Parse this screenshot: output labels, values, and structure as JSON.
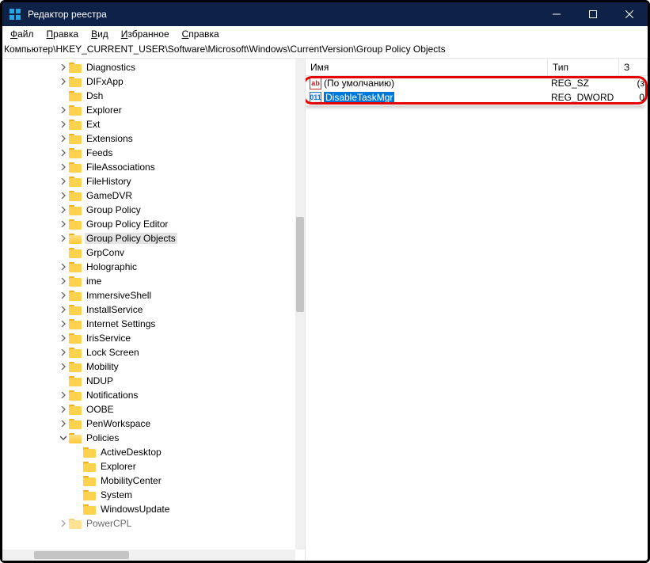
{
  "window": {
    "title": "Редактор реестра"
  },
  "menu": {
    "file": "Файл",
    "edit": "Правка",
    "view": "Вид",
    "favorites": "Избранное",
    "help": "Справка"
  },
  "addressbar": "Компьютер\\HKEY_CURRENT_USER\\Software\\Microsoft\\Windows\\CurrentVersion\\Group Policy Objects",
  "tree": [
    {
      "level": 0,
      "chev": ">",
      "label": "Diagnostics"
    },
    {
      "level": 0,
      "chev": ">",
      "label": "DIFxApp"
    },
    {
      "level": 0,
      "chev": "",
      "label": "Dsh"
    },
    {
      "level": 0,
      "chev": ">",
      "label": "Explorer"
    },
    {
      "level": 0,
      "chev": ">",
      "label": "Ext"
    },
    {
      "level": 0,
      "chev": ">",
      "label": "Extensions"
    },
    {
      "level": 0,
      "chev": ">",
      "label": "Feeds"
    },
    {
      "level": 0,
      "chev": ">",
      "label": "FileAssociations"
    },
    {
      "level": 0,
      "chev": ">",
      "label": "FileHistory"
    },
    {
      "level": 0,
      "chev": ">",
      "label": "GameDVR"
    },
    {
      "level": 0,
      "chev": ">",
      "label": "Group Policy"
    },
    {
      "level": 0,
      "chev": ">",
      "label": "Group Policy Editor"
    },
    {
      "level": 0,
      "chev": ">",
      "label": "Group Policy Objects",
      "selected": true,
      "open": true
    },
    {
      "level": 0,
      "chev": "",
      "label": "GrpConv"
    },
    {
      "level": 0,
      "chev": ">",
      "label": "Holographic"
    },
    {
      "level": 0,
      "chev": ">",
      "label": "ime"
    },
    {
      "level": 0,
      "chev": ">",
      "label": "ImmersiveShell"
    },
    {
      "level": 0,
      "chev": ">",
      "label": "InstallService"
    },
    {
      "level": 0,
      "chev": ">",
      "label": "Internet Settings"
    },
    {
      "level": 0,
      "chev": ">",
      "label": "IrisService"
    },
    {
      "level": 0,
      "chev": ">",
      "label": "Lock Screen"
    },
    {
      "level": 0,
      "chev": ">",
      "label": "Mobility"
    },
    {
      "level": 0,
      "chev": "",
      "label": "NDUP"
    },
    {
      "level": 0,
      "chev": ">",
      "label": "Notifications"
    },
    {
      "level": 0,
      "chev": ">",
      "label": "OOBE"
    },
    {
      "level": 0,
      "chev": ">",
      "label": "PenWorkspace"
    },
    {
      "level": 0,
      "chev": "v",
      "label": "Policies",
      "open": true
    },
    {
      "level": 1,
      "chev": "",
      "label": "ActiveDesktop"
    },
    {
      "level": 1,
      "chev": "",
      "label": "Explorer"
    },
    {
      "level": 1,
      "chev": "",
      "label": "MobilityCenter"
    },
    {
      "level": 1,
      "chev": "",
      "label": "System"
    },
    {
      "level": 1,
      "chev": "",
      "label": "WindowsUpdate"
    },
    {
      "level": 0,
      "chev": ">",
      "label": "PowerCPL",
      "cutoff": true
    }
  ],
  "list": {
    "headers": {
      "name": "Имя",
      "type": "Тип",
      "data": "З"
    },
    "rows": [
      {
        "icon": "sz",
        "name": "(По умолчанию)",
        "type": "REG_SZ",
        "data": "(з",
        "selected": false
      },
      {
        "icon": "dw",
        "name": "DisableTaskMgr",
        "type": "REG_DWORD",
        "data": "0",
        "selected": true
      }
    ]
  }
}
